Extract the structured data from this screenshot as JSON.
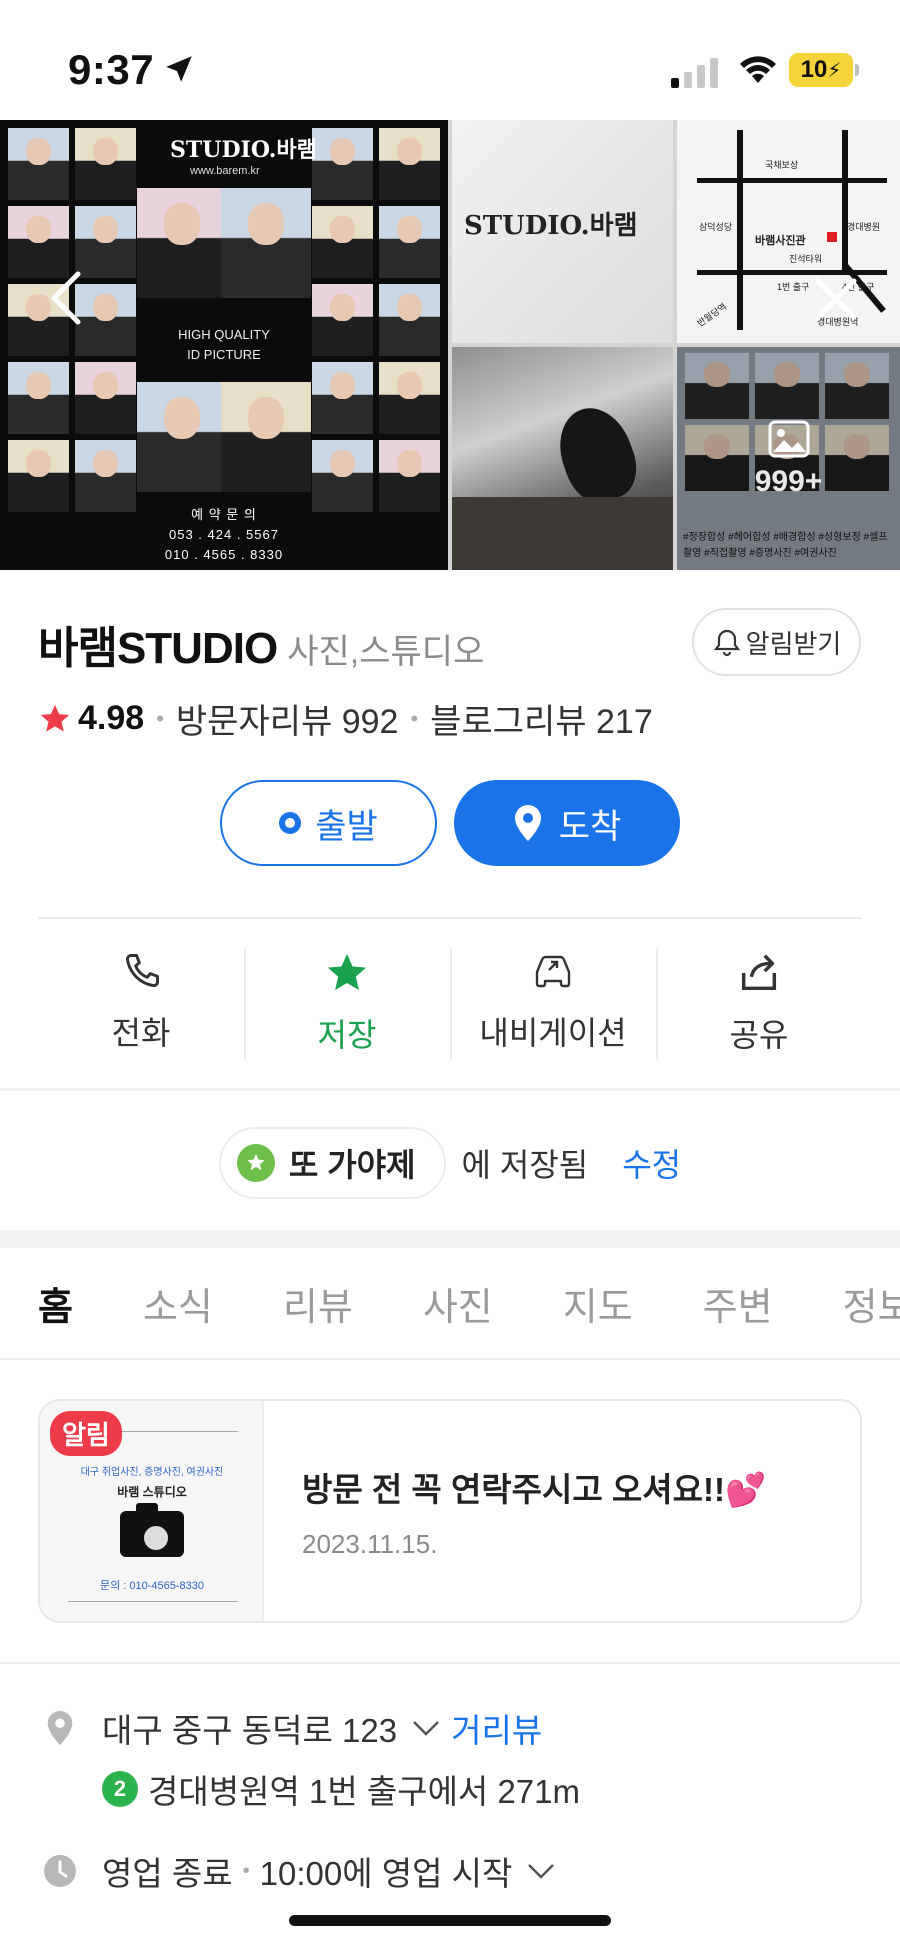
{
  "status_bar": {
    "time": "9:37",
    "battery": "10"
  },
  "gallery": {
    "main_brand": "STUDIO.바램",
    "main_url": "www.barem.kr",
    "main_tagline_1": "HIGH QUALITY",
    "main_tagline_2": "ID PICTURE",
    "main_booking_label": "예 약 문 의",
    "main_phone_1": "053 . 424 . 5567",
    "main_phone_2": "010 . 4565 . 8330",
    "logo_text": "STUDIO.바램",
    "map_labels": [
      "국채보상",
      "경대병원",
      "삼덕성당",
      "바램사진관",
      "진석타워",
      "1번 출구",
      "4번 출구",
      "반월당역",
      "경대병원역"
    ],
    "more_count": "999+",
    "more_tags": "#정장합성 #헤어합성 #배경합성 #성형보정 #셀프촬영 #직접촬영 #증명사진 #여권사진"
  },
  "place": {
    "name": "바램STUDIO",
    "category": "사진,스튜디오",
    "alarm_label": "알림받기",
    "rating": "4.98",
    "visitor_reviews": "방문자리뷰 992",
    "blog_reviews": "블로그리뷰 217"
  },
  "route": {
    "depart_label": "출발",
    "arrive_label": "도착"
  },
  "actions": [
    {
      "label": "전화",
      "icon": "phone-icon"
    },
    {
      "label": "저장",
      "icon": "star-icon"
    },
    {
      "label": "내비게이션",
      "icon": "car-icon"
    },
    {
      "label": "공유",
      "icon": "share-icon"
    }
  ],
  "saved": {
    "list_name": "또 가야제",
    "suffix": "에 저장됨",
    "edit_label": "수정"
  },
  "tabs": [
    "홈",
    "소식",
    "리뷰",
    "사진",
    "지도",
    "주변",
    "정보"
  ],
  "notice": {
    "badge": "알림",
    "thumb_line": "대구 취업사진, 증명사진, 여권사진",
    "thumb_title": "바램 스튜디오",
    "thumb_phone": "문의 : 010-4565-8330",
    "text": "방문 전 꼭 연락주시고 오셔요!!💕",
    "date": "2023.11.15."
  },
  "info": {
    "address": "대구 중구 동덕로 123",
    "street_view_label": "거리뷰",
    "subway_line": "2",
    "subway_text": "경대병원역 1번 출구에서 271m",
    "hours_status": "영업 종료",
    "hours_next": "10:00에 영업 시작"
  },
  "colors": {
    "accent": "#1a73e8",
    "saved_green": "#1aa14d",
    "star_red": "#ee3b4a",
    "subway_green": "#2bb24c"
  }
}
